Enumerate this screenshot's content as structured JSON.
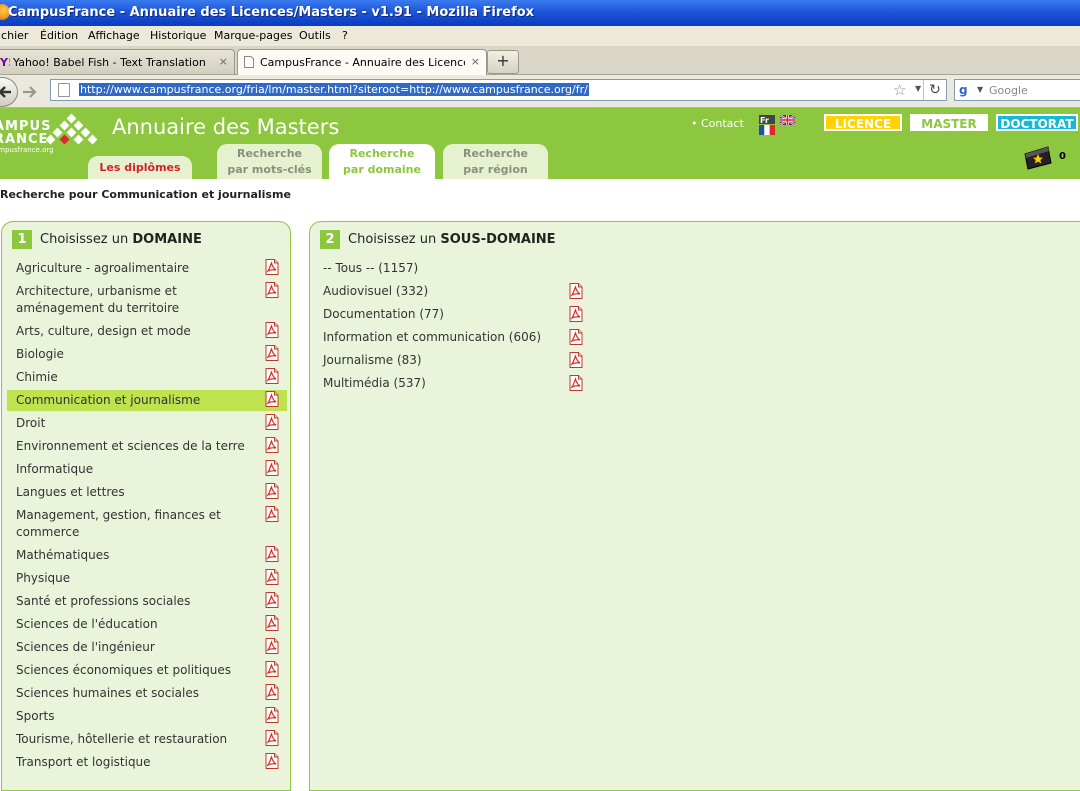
{
  "window": {
    "title": "CampusFrance - Annuaire des Licences/Masters - v1.91 - Mozilla Firefox"
  },
  "menu": [
    "ichier",
    "Édition",
    "Affichage",
    "Historique",
    "Marque-pages",
    "Outils",
    "?"
  ],
  "tabs": [
    {
      "label": "Yahoo! Babel Fish - Text Translation and ...",
      "close": "×"
    },
    {
      "label": "CampusFrance - Annuaire des Licences/...",
      "close": "×"
    }
  ],
  "newtab_label": "+",
  "address": {
    "url": "http://www.campusfrance.org/fria/lm/master.html?siteroot=http://www.campusfrance.org/fr/"
  },
  "search": {
    "placeholder": "Google"
  },
  "site": {
    "logo_line1": "AMPUS",
    "logo_line2": "RANCE",
    "logo_line3": "ampusfrance.org",
    "title": "Annuaire des Masters",
    "contact": "• Contact",
    "flag_fr_label": "Fr",
    "levels": {
      "licence": "LICENCE",
      "master": "MASTER",
      "doctorat": "DOCTORAT"
    },
    "basket_count": "0",
    "nav": {
      "diplomes": "Les diplômes",
      "motscles_1": "Recherche",
      "motscles_2": "par mots-clés",
      "domaine_1": "Recherche",
      "domaine_2": "par domaine",
      "region_1": "Recherche",
      "region_2": "par région"
    },
    "search_for": "Recherche pour Communication et journalisme"
  },
  "panel1": {
    "number": "1",
    "heading_prefix": "Choisissez un",
    "heading_bold": "DOMAINE",
    "items": [
      "Agriculture - agroalimentaire",
      "Architecture, urbanisme et aménagement du territoire",
      "Arts, culture, design et mode",
      "Biologie",
      "Chimie",
      "Communication et journalisme",
      "Droit",
      "Environnement et sciences de la terre",
      "Informatique",
      "Langues et lettres",
      "Management, gestion, finances et commerce",
      "Mathématiques",
      "Physique",
      "Santé et professions sociales",
      "Sciences de l'éducation",
      "Sciences de l'ingénieur",
      "Sciences économiques et politiques",
      "Sciences humaines et sociales",
      "Sports",
      "Tourisme, hôtellerie et restauration",
      "Transport et logistique"
    ],
    "selected": "Communication et journalisme"
  },
  "panel2": {
    "number": "2",
    "heading_prefix": "Choisissez un",
    "heading_bold": "SOUS-DOMAINE",
    "items": [
      "-- Tous -- (1157)",
      "Audiovisuel (332)",
      "Documentation (77)",
      "Information et communication (606)",
      "Journalisme (83)",
      "Multimédia (537)"
    ]
  },
  "colors": {
    "site_green": "#8dc63f",
    "licence": "#ffd200",
    "doctorat": "#17b9d2",
    "selected_row": "#bfe24f",
    "panel_bg": "#eaf4da"
  }
}
